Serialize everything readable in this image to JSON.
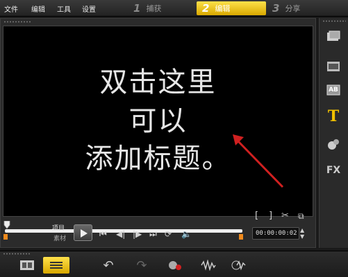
{
  "menu": {
    "file": "文件",
    "edit": "编辑",
    "tools": "工具",
    "settings": "设置"
  },
  "steps": [
    {
      "num": "1",
      "label": "捕获"
    },
    {
      "num": "2",
      "label": "编辑"
    },
    {
      "num": "3",
      "label": "分享"
    }
  ],
  "preview": {
    "lines": [
      "双击这里",
      "可以",
      "添加标题。"
    ]
  },
  "playback": {
    "mode_project": "项目",
    "mode_clip": "素材",
    "timecode": "00:00:00:02",
    "position": 0.0
  },
  "colors": {
    "accent": "#f0c000",
    "trim": "#f08a1c",
    "arrow": "#d02020"
  },
  "right_tools": [
    "media-icon",
    "transition-icon",
    "overlay-icon",
    "title-icon",
    "graphics-icon",
    "filter-icon"
  ],
  "right_tools_fx_label": "FX",
  "right_tools_ab_label": "AB",
  "bottom_tools": [
    "storyboard-view-icon",
    "timeline-view-icon",
    "undo-icon",
    "redo-icon",
    "record-capture-icon",
    "audio-mix-icon",
    "auto-music-icon"
  ]
}
